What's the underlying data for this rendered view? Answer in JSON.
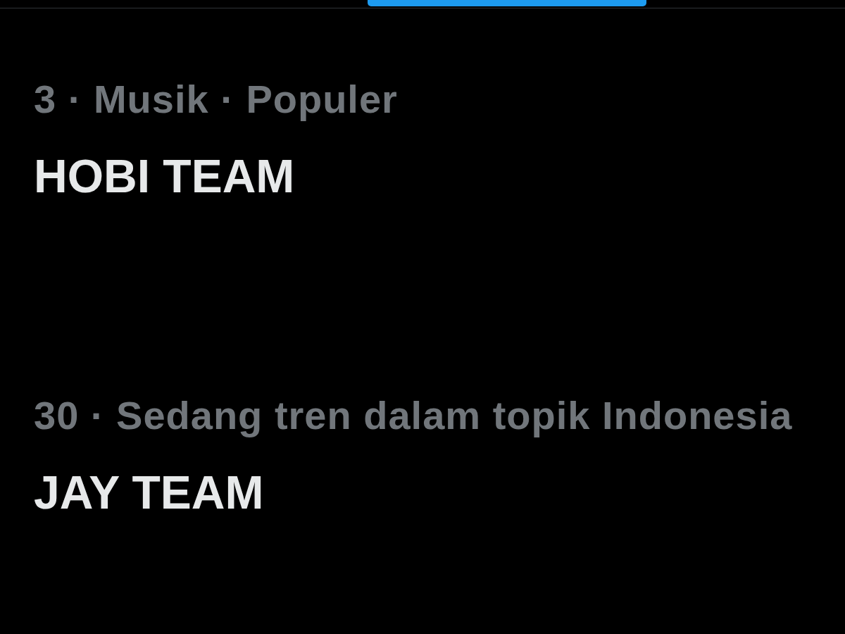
{
  "tabs": [
    {
      "selected": true
    }
  ],
  "trends": [
    {
      "context": "3 · Musik · Populer",
      "title": "HOBI TEAM"
    },
    {
      "context": "30 · Sedang tren dalam topik Indonesia",
      "title": "JAY TEAM"
    }
  ]
}
